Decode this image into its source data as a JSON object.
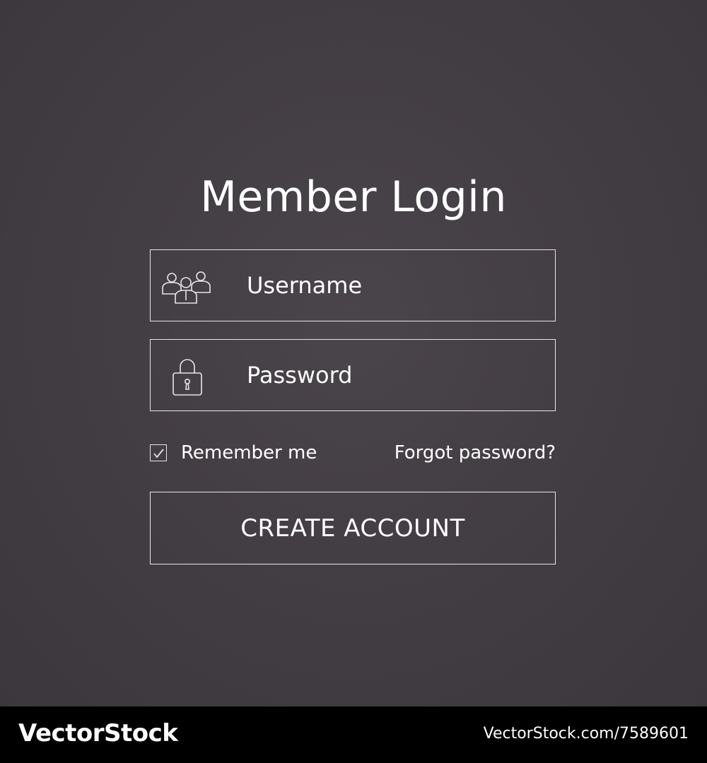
{
  "login": {
    "title": "Member Login",
    "username": {
      "placeholder": "Username",
      "icon": "users-group-icon"
    },
    "password": {
      "placeholder": "Password",
      "icon": "padlock-icon"
    },
    "remember_label": "Remember me",
    "remember_checked": true,
    "forgot_label": "Forgot password?",
    "create_label": "CREATE ACCOUNT"
  },
  "watermark": {
    "brand": "VectorStock",
    "image_id": "VectorStock.com/7589601"
  },
  "colors": {
    "background": "#433e44",
    "line": "#e8e6ea",
    "text": "#ffffff",
    "footer": "#000000"
  }
}
